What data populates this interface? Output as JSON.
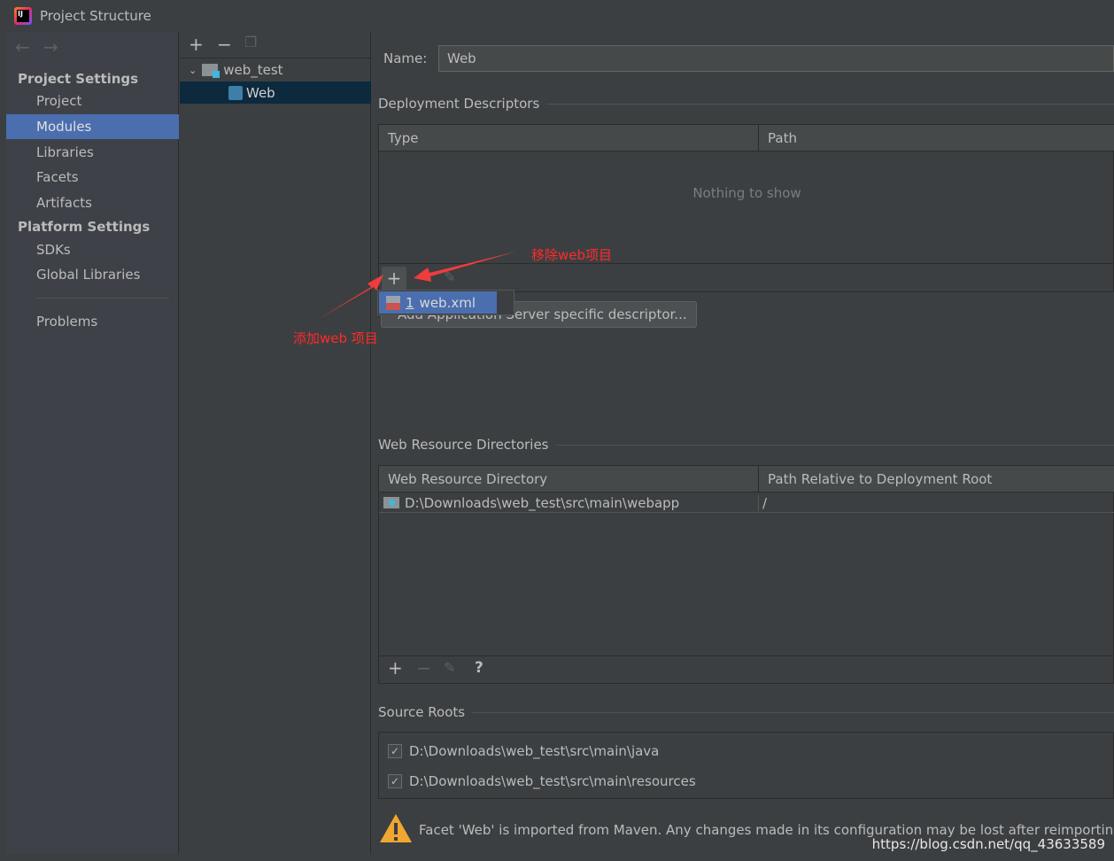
{
  "window": {
    "title": "Project Structure"
  },
  "sidebar": {
    "project_settings": "Project Settings",
    "items": [
      "Project",
      "Modules",
      "Libraries",
      "Facets",
      "Artifacts"
    ],
    "platform_settings": "Platform Settings",
    "platform_items": [
      "SDKs",
      "Global Libraries"
    ],
    "problems": "Problems",
    "selected": "Modules"
  },
  "tree": {
    "root": "web_test",
    "child": "Web"
  },
  "name_field": {
    "label": "Name:",
    "value": "Web"
  },
  "deployment": {
    "title": "Deployment Descriptors",
    "columns": [
      "Type",
      "Path"
    ],
    "empty": "Nothing to show",
    "popup_item_num": "1",
    "popup_item": "web.xml",
    "button": "Add Application Server specific descriptor..."
  },
  "annotations": {
    "remove": "移除web项目",
    "add": "添加web 项目",
    "color": "#ff2a2a"
  },
  "web_resources": {
    "title": "Web Resource Directories",
    "columns": [
      "Web Resource Directory",
      "Path Relative to Deployment Root"
    ],
    "rows": [
      {
        "dir": "D:\\Downloads\\web_test\\src\\main\\webapp",
        "path": "/"
      }
    ],
    "help": "?"
  },
  "source_roots": {
    "title": "Source Roots",
    "items": [
      {
        "path": "D:\\Downloads\\web_test\\src\\main\\java",
        "checked": true
      },
      {
        "path": "D:\\Downloads\\web_test\\src\\main\\resources",
        "checked": true
      }
    ]
  },
  "warning": "Facet 'Web' is imported from Maven. Any changes made in its configuration may be lost after reimporting.",
  "watermark": "https://blog.csdn.net/qq_43633589",
  "colors": {
    "selection": "#4b6eaf",
    "tree_selection": "#0d293e",
    "warning": "#f0a732"
  }
}
